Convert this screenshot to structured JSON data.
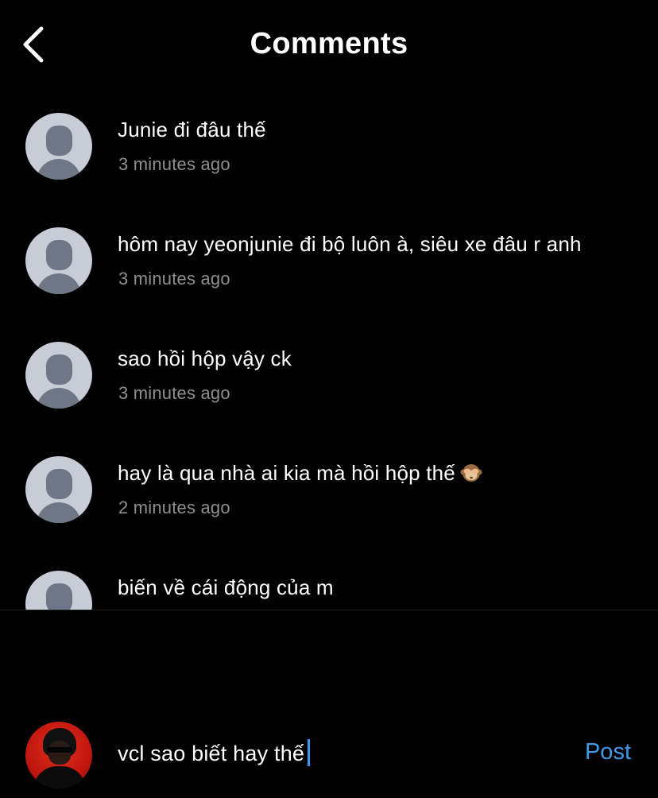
{
  "header": {
    "title": "Comments",
    "back_icon": "chevron-left-icon"
  },
  "comments": [
    {
      "text": "Junie đi đâu thế",
      "time": "3 minutes ago"
    },
    {
      "text": "hôm nay yeonjunie đi bộ luôn à, siêu xe đâu r anh",
      "time": "3 minutes ago"
    },
    {
      "text": "sao hồi hộp vậy ck",
      "time": "3 minutes ago"
    },
    {
      "text": "hay là qua nhà ai kia mà hồi hộp thế",
      "emoji": "see-no-evil-monkey-icon",
      "time": "2 minutes ago"
    },
    {
      "text": "biến về cái động của m",
      "time": ""
    }
  ],
  "composer": {
    "value": "vcl sao biết hay thế",
    "post_label": "Post"
  },
  "colors": {
    "background": "#000000",
    "accent": "#3f9bea",
    "secondary_text": "#8e8e8e",
    "avatar_placeholder": "#c7ccd6"
  }
}
